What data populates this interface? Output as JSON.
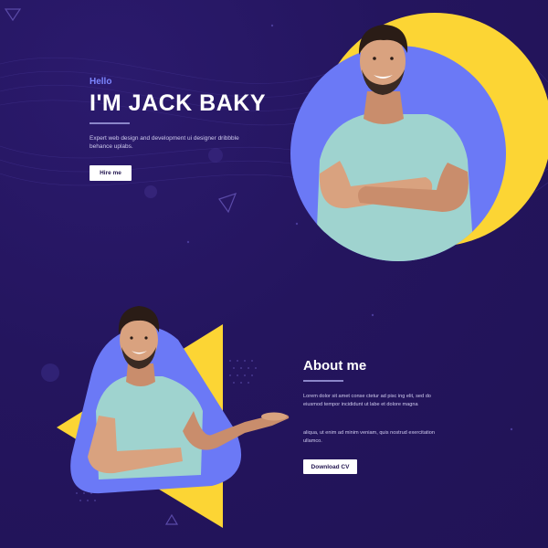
{
  "hero": {
    "greeting": "Hello",
    "title": "I'M JACK BAKY",
    "description": "Expert web design and development ui designer dribbble behance uplabs.",
    "hire_button": "Hire me"
  },
  "about": {
    "title": "About me",
    "paragraph1": "Lorem dolor sit amet conse ctetur ad pisc ing elit, sed do eiusmod tempor incididunt ut labe et dolore magna",
    "paragraph2": "aliqua, ut enim ad minim veniam, quis nostrud exercitation ullamco.",
    "download_button": "Download CV"
  },
  "colors": {
    "background": "#24155e",
    "accent_yellow": "#fcd534",
    "accent_blue": "#6b79f6",
    "accent_text": "#7c86ff",
    "shirt": "#9fd3cf"
  }
}
